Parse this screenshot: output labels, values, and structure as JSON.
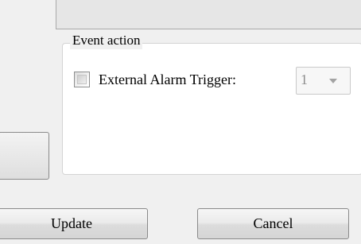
{
  "event_action": {
    "title": "Event action",
    "external_alarm": {
      "label": "External Alarm Trigger:",
      "checked": false,
      "selected_value": "1"
    }
  },
  "buttons": {
    "update_label": "Update",
    "cancel_label": "Cancel"
  },
  "icons": {
    "dropdown": "chevron-down-icon"
  }
}
